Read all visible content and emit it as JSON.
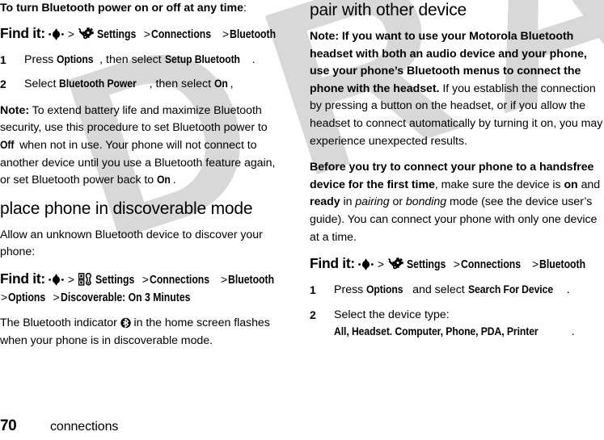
{
  "page": {
    "number": "70",
    "section": "connections",
    "watermark": "DRAFT"
  },
  "icons": {
    "joystick": "joystick-center-key-icon",
    "settings_gear": "settings-wrench-gear-icon",
    "settings_box": "settings-box-wrench-icon",
    "bluetooth_indicator": "bluetooth-indicator-icon"
  },
  "left_column": {
    "intro_bold": "To turn Bluetooth power on or off at any time",
    "intro_tail": ":",
    "findit_1": {
      "label": "Find it:",
      "crumbs": [
        "Settings",
        "Connections",
        "Bluetooth"
      ]
    },
    "steps_1": [
      {
        "num": "1",
        "parts": [
          {
            "t": "Press ",
            "s": "plain"
          },
          {
            "t": "Options",
            "s": "ui"
          },
          {
            "t": ", then select ",
            "s": "plain"
          },
          {
            "t": "Setup Bluetooth",
            "s": "ui"
          },
          {
            "t": ".",
            "s": "plain"
          }
        ]
      },
      {
        "num": "2",
        "parts": [
          {
            "t": "Select ",
            "s": "plain"
          },
          {
            "t": "Bluetooth Power",
            "s": "ui"
          },
          {
            "t": ", then select ",
            "s": "plain"
          },
          {
            "t": "On",
            "s": "ui"
          },
          {
            "t": ",",
            "s": "plain"
          }
        ]
      }
    ],
    "note": [
      {
        "t": "Note:",
        "s": "bold"
      },
      {
        "t": " To extend battery life and maximize Bluetooth security, use this procedure to set Bluetooth power to ",
        "s": "plain"
      },
      {
        "t": "Off",
        "s": "ui"
      },
      {
        "t": " when not in use. Your phone will not connect to another device until you use a Bluetooth feature again, or set Bluetooth power back to ",
        "s": "plain"
      },
      {
        "t": "On",
        "s": "ui"
      },
      {
        "t": ".",
        "s": "plain"
      }
    ],
    "heading_2": "place phone in discoverable mode",
    "para_2": "Allow an unknown Bluetooth device to discover your phone:",
    "findit_2": {
      "label": "Find it:",
      "crumbs": [
        "Settings",
        "Connections",
        "Bluetooth",
        "Options",
        "Discoverable: On 3 Minutes"
      ]
    },
    "closing": [
      {
        "t": "The Bluetooth indicator ",
        "s": "plain"
      },
      {
        "t": "@bt-icon",
        "s": "icon"
      },
      {
        "t": " in the home screen flashes when your phone is in discoverable mode.",
        "s": "plain"
      }
    ]
  },
  "right_column": {
    "heading_1": "pair with other device",
    "note": [
      {
        "t": "Note: If you want to use your Motorola Bluetooth headset with both an audio device and your phone, use your phone’s Bluetooth menus to connect the phone with the headset.",
        "s": "bold"
      },
      {
        "t": " If you establish the connection by pressing a button on the headset, or if you allow the headset to connect automatically by turning it on, you may experience unexpected results.",
        "s": "plain"
      }
    ],
    "before": [
      {
        "t": "Before you try to connect your phone to a handsfree device for the first time",
        "s": "bold"
      },
      {
        "t": ", make sure the device is ",
        "s": "plain"
      },
      {
        "t": "on",
        "s": "bold"
      },
      {
        "t": " and ",
        "s": "plain"
      },
      {
        "t": "ready",
        "s": "bold"
      },
      {
        "t": " in ",
        "s": "plain"
      },
      {
        "t": "pairing",
        "s": "ital"
      },
      {
        "t": " or ",
        "s": "plain"
      },
      {
        "t": "bonding",
        "s": "ital"
      },
      {
        "t": " mode (see the device user’s guide). You can connect your phone with only one device at a time.",
        "s": "plain"
      }
    ],
    "findit_1": {
      "label": "Find it:",
      "crumbs": [
        "Settings",
        "Connections",
        "Bluetooth"
      ]
    },
    "steps_1": [
      {
        "num": "1",
        "parts": [
          {
            "t": "Press ",
            "s": "plain"
          },
          {
            "t": "Options",
            "s": "ui"
          },
          {
            "t": " and select ",
            "s": "plain"
          },
          {
            "t": "Search For Device",
            "s": "ui"
          },
          {
            "t": ".",
            "s": "plain"
          }
        ]
      },
      {
        "num": "2",
        "parts": [
          {
            "t": "Select the device type: ",
            "s": "plain"
          },
          {
            "t": "All, Headset. Computer, Phone, PDA, Printer",
            "s": "ui"
          },
          {
            "t": ".",
            "s": "plain"
          }
        ]
      }
    ]
  }
}
